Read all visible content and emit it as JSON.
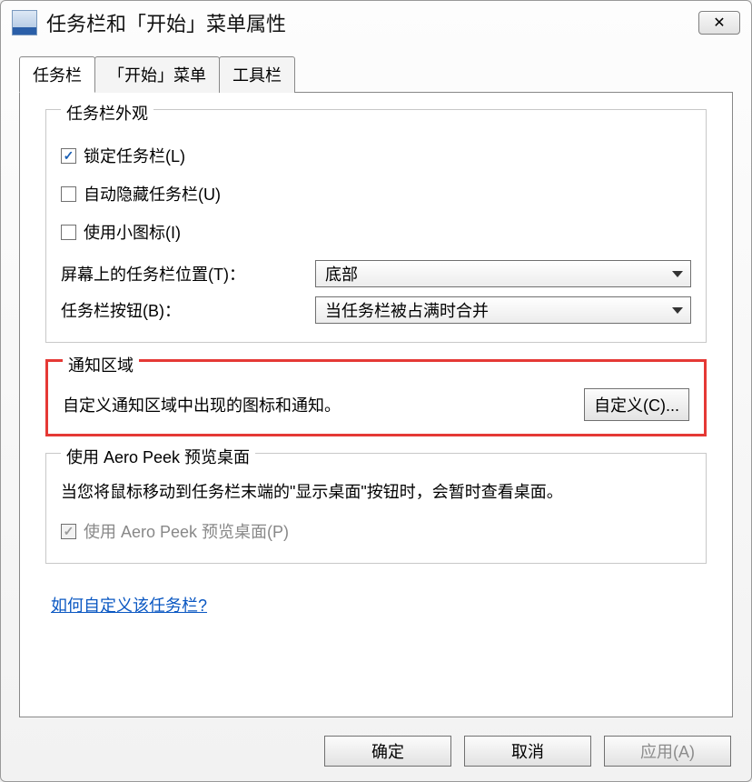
{
  "window": {
    "title": "任务栏和「开始」菜单属性",
    "close_symbol": "✕"
  },
  "tabs": {
    "taskbar": "任务栏",
    "start_menu": "「开始」菜单",
    "toolbars": "工具栏"
  },
  "appearance": {
    "group_title": "任务栏外观",
    "lock_taskbar": "锁定任务栏(L)",
    "auto_hide": "自动隐藏任务栏(U)",
    "small_icons": "使用小图标(I)",
    "position_label": "屏幕上的任务栏位置(T)：",
    "position_value": "底部",
    "buttons_label": "任务栏按钮(B)：",
    "buttons_value": "当任务栏被占满时合并"
  },
  "notification": {
    "group_title": "通知区域",
    "description": "自定义通知区域中出现的图标和通知。",
    "customize_button": "自定义(C)..."
  },
  "aero": {
    "group_title": "使用 Aero Peek 预览桌面",
    "description": "当您将鼠标移动到任务栏末端的\"显示桌面\"按钮时，会暂时查看桌面。",
    "checkbox_label": "使用 Aero Peek 预览桌面(P)"
  },
  "help_link": "如何自定义该任务栏?",
  "footer": {
    "ok": "确定",
    "cancel": "取消",
    "apply": "应用(A)"
  }
}
